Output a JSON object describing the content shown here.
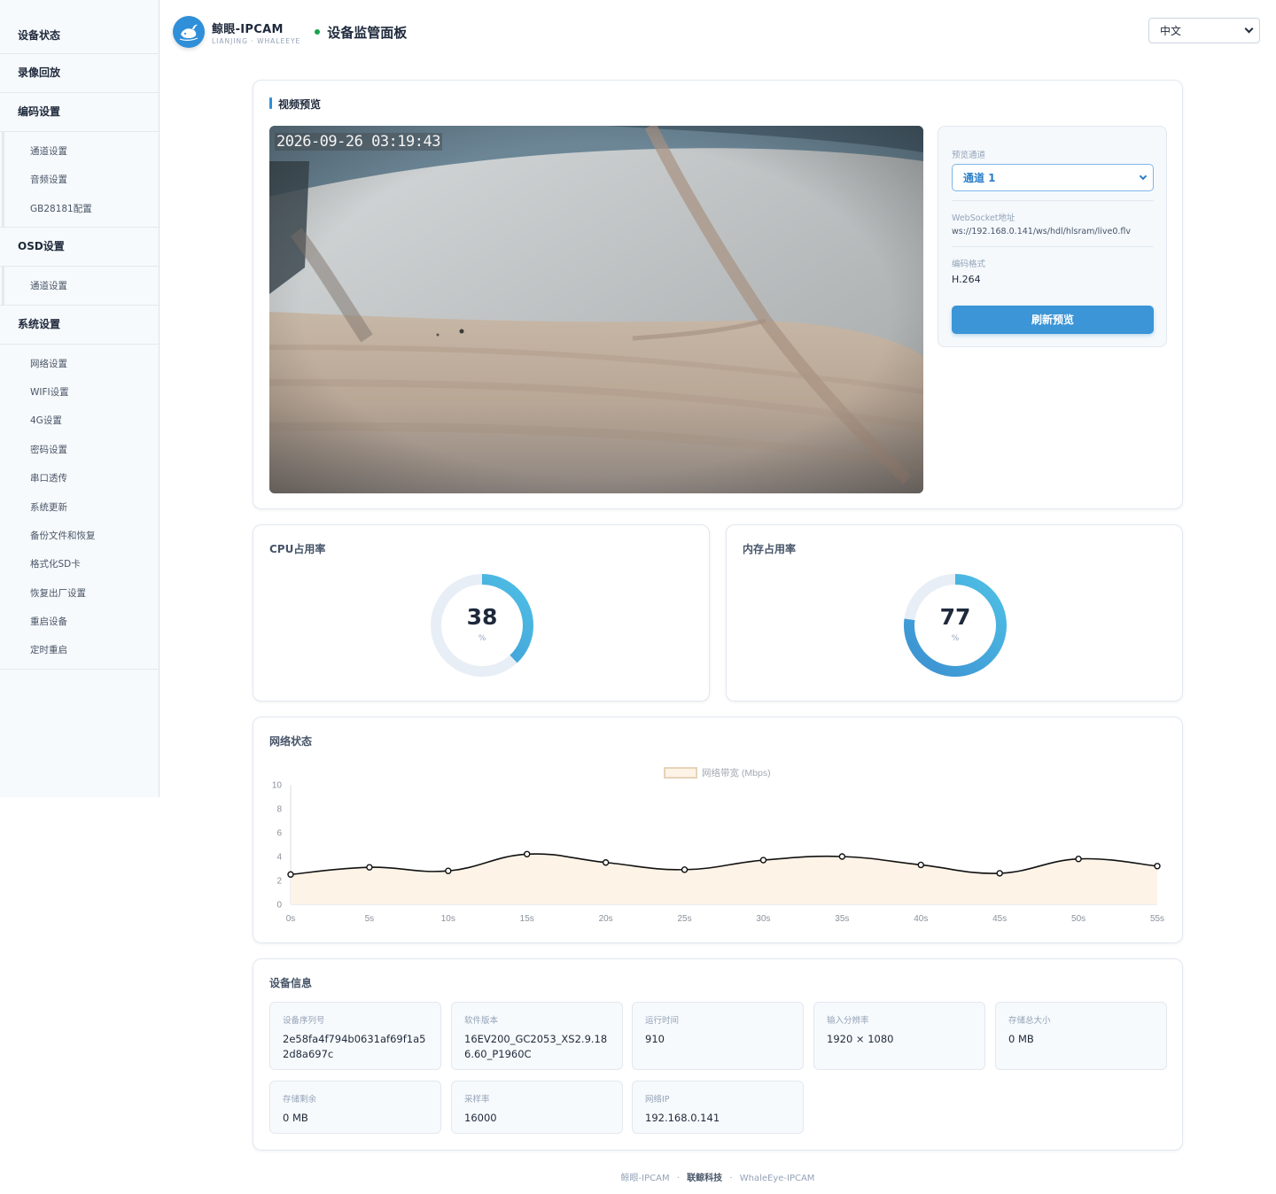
{
  "sidebar": {
    "groups": [
      {
        "label": "设备状态",
        "items": []
      },
      {
        "label": "录像回放",
        "items": []
      },
      {
        "label": "编码设置",
        "items": [
          "通道设置",
          "音频设置",
          "GB28181配置"
        ]
      },
      {
        "label": "OSD设置",
        "items": [
          "通道设置"
        ]
      },
      {
        "label": "系统设置",
        "items": [
          "网络设置",
          "WIFI设置",
          "4G设置",
          "密码设置",
          "串口透传",
          "系统更新",
          "备份文件和恢复",
          "格式化SD卡",
          "恢复出厂设置",
          "重启设备",
          "定时重启"
        ]
      }
    ]
  },
  "header": {
    "brand_name": "鲸眼-IPCAM",
    "brand_sub": "LIANJING · WHALEEYE",
    "title": "设备监管面板",
    "language": "中文",
    "status_color": "#16a34a",
    "logo_icon": "whale-icon"
  },
  "video_card": {
    "title": "视频预览",
    "timestamp": "2026-09-26 03:19:43",
    "panel": {
      "channel_label": "预览通道",
      "channel_value": "通道 1",
      "ws_label": "WebSocket地址",
      "ws_value": "ws://192.168.0.141/ws/hdl/hlsram/live0.flv",
      "codec_label": "编码格式",
      "codec_value": "H.264",
      "refresh_label": "刷新预览"
    }
  },
  "cpu": {
    "title": "CPU占用率",
    "value": "38",
    "unit": "%",
    "percent": 38
  },
  "memory": {
    "title": "内存占用率",
    "value": "77",
    "unit": "%",
    "percent": 77
  },
  "network": {
    "title": "网络状态"
  },
  "chart_data": {
    "type": "line",
    "title": "",
    "xlabel": "",
    "ylabel": "",
    "x": [
      "0s",
      "5s",
      "10s",
      "15s",
      "20s",
      "25s",
      "30s",
      "35s",
      "40s",
      "45s",
      "50s",
      "55s"
    ],
    "series": [
      {
        "name": "网络带宽 (Mbps)",
        "values": [
          2.5,
          3.1,
          2.8,
          4.2,
          3.5,
          2.9,
          3.7,
          4.0,
          3.3,
          2.6,
          3.8,
          3.2
        ]
      }
    ],
    "ylim": [
      0,
      10
    ],
    "yticks": [
      "0",
      "2",
      "4",
      "6",
      "8",
      "10"
    ],
    "legend": "top-center",
    "area_fill": true,
    "colors": {
      "line": "#111111",
      "fill": "#fdf3e6",
      "legend_border": "#e6d3b8"
    }
  },
  "device_info": {
    "title": "设备信息",
    "items": [
      {
        "label": "设备序列号",
        "value": "2e58fa4f794b0631af69f1a52d8a697c"
      },
      {
        "label": "软件版本",
        "value": "16EV200_GC2053_XS2.9.186.60_P1960C"
      },
      {
        "label": "运行时间",
        "value": "910"
      },
      {
        "label": "输入分辨率",
        "value": "1920 × 1080"
      },
      {
        "label": "存储总大小",
        "value": "0 MB"
      },
      {
        "label": "存储剩余",
        "value": "0 MB"
      },
      {
        "label": "采样率",
        "value": "16000"
      },
      {
        "label": "网络IP",
        "value": "192.168.0.141"
      }
    ]
  },
  "footer": {
    "left": "鲸眼-IPCAM",
    "sep": "·",
    "middle": "联鲸科技",
    "right": "WhaleEye-IPCAM"
  },
  "colors": {
    "accent": "#2f8fd8",
    "button": "#3b95d6",
    "gauge_track": "#e8eef5"
  }
}
